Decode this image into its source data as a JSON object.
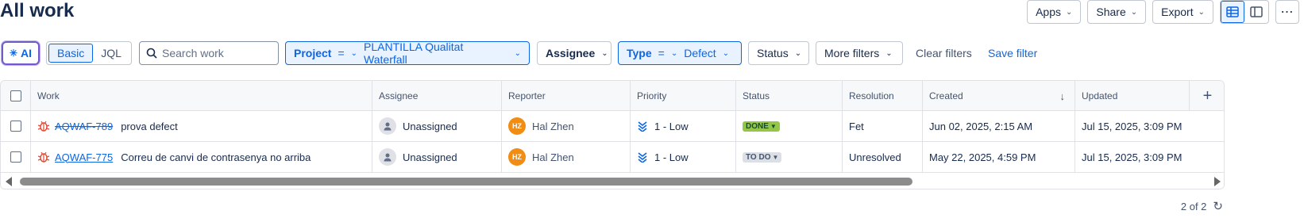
{
  "page": {
    "title": "All work"
  },
  "top_actions": {
    "apps": "Apps",
    "share": "Share",
    "export": "Export",
    "list_view_icon": "list-view-icon",
    "detail_view_icon": "detail-view-icon",
    "more_icon": "more-icon"
  },
  "filters": {
    "ai_label": "AI",
    "mode_basic": "Basic",
    "mode_jql": "JQL",
    "search_placeholder": "Search work",
    "project": {
      "key": "Project",
      "op": "=",
      "value": "PLANTILLA Qualitat Waterfall"
    },
    "assignee": "Assignee",
    "type": {
      "key": "Type",
      "op": "=",
      "value": "Defect"
    },
    "status": "Status",
    "more_filters": "More filters",
    "clear_filters": "Clear filters",
    "save_filter": "Save filter"
  },
  "table": {
    "columns": [
      "Work",
      "Assignee",
      "Reporter",
      "Priority",
      "Status",
      "Resolution",
      "Created",
      "Updated"
    ],
    "rows": [
      {
        "key": "AQWAF-789",
        "summary": "prova defect",
        "assignee": "Unassigned",
        "reporter": "Hal Zhen",
        "reporter_initials": "HZ",
        "priority": "1 - Low",
        "status": "DONE",
        "resolution": "Fet",
        "created": "Jun 02, 2025, 2:15 AM",
        "updated": "Jul 15, 2025, 3:09 PM"
      },
      {
        "key": "AQWAF-775",
        "summary": "Correu de canvi de contrasenya no arriba",
        "assignee": "Unassigned",
        "reporter": "Hal Zhen",
        "reporter_initials": "HZ",
        "priority": "1 - Low",
        "status": "TO DO",
        "resolution": "Unresolved",
        "created": "May 22, 2025, 4:59 PM",
        "updated": "Jul 15, 2025, 3:09 PM"
      }
    ]
  },
  "footer": {
    "count": "2 of 2"
  },
  "colors": {
    "accent": "#0c66e4",
    "done": "#94c748",
    "avatar": "#f18d13",
    "bug": "#e34935"
  }
}
